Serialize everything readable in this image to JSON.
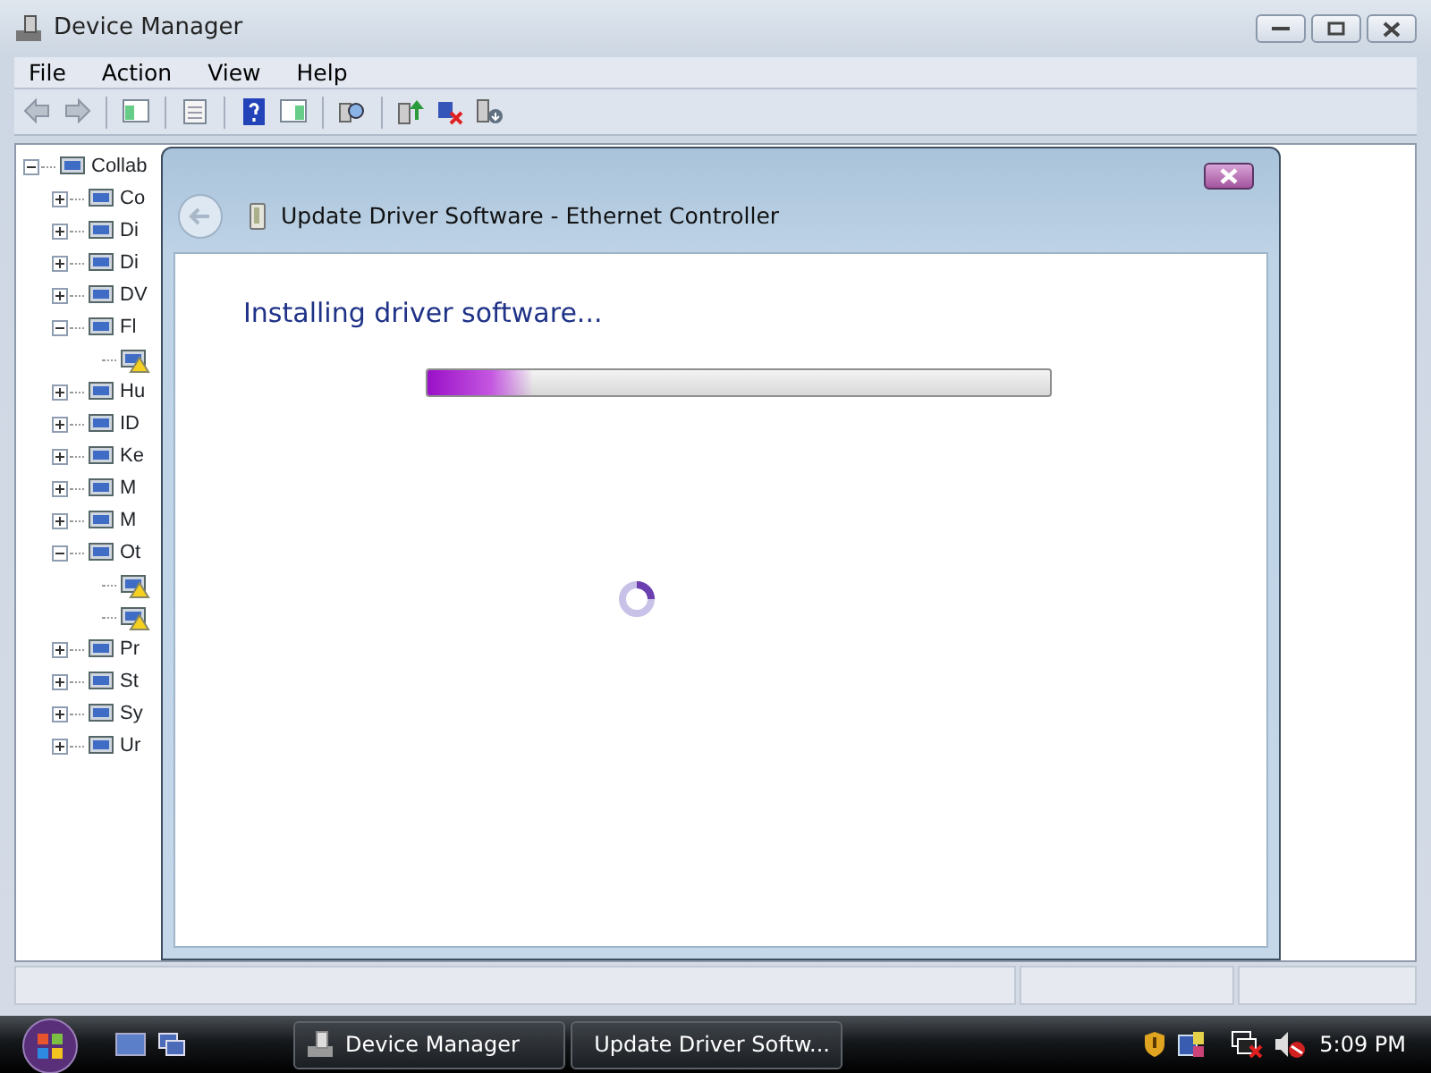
{
  "window": {
    "title": "Device Manager"
  },
  "menu": [
    {
      "label": "File"
    },
    {
      "label": "Action"
    },
    {
      "label": "View"
    },
    {
      "label": "Help"
    }
  ],
  "tree": [
    {
      "label": "Collab",
      "expanded": true,
      "warning": false,
      "children": [
        {
          "label": "Co",
          "expanded": false,
          "warning": false
        },
        {
          "label": "Di",
          "expanded": false,
          "warning": false
        },
        {
          "label": "Di",
          "expanded": false,
          "warning": false
        },
        {
          "label": "DV",
          "expanded": false,
          "warning": false
        },
        {
          "label": "Fl",
          "expanded": true,
          "warning": false,
          "children": [
            {
              "warning": true
            }
          ]
        },
        {
          "label": "Hu",
          "expanded": false,
          "warning": false
        },
        {
          "label": "ID",
          "expanded": false,
          "warning": false
        },
        {
          "label": "Ke",
          "expanded": false,
          "warning": false
        },
        {
          "label": "M",
          "expanded": false,
          "warning": false
        },
        {
          "label": "M",
          "expanded": false,
          "warning": false
        },
        {
          "label": "Ot",
          "expanded": true,
          "warning": false,
          "children": [
            {
              "warning": true
            },
            {
              "warning": true
            }
          ]
        },
        {
          "label": "Pr",
          "expanded": false,
          "warning": false
        },
        {
          "label": "St",
          "expanded": false,
          "warning": false
        },
        {
          "label": "Sy",
          "expanded": false,
          "warning": false
        },
        {
          "label": "Ur",
          "expanded": false,
          "warning": false
        }
      ]
    }
  ],
  "dialog": {
    "title": "Update Driver Software - Ethernet Controller",
    "heading": "Installing driver software...",
    "progress": {
      "level": 0.17
    }
  },
  "taskbar": {
    "tasks": [
      {
        "label": "Device Manager"
      },
      {
        "label": "Update Driver Softw..."
      }
    ],
    "clock": "5:09 PM"
  }
}
